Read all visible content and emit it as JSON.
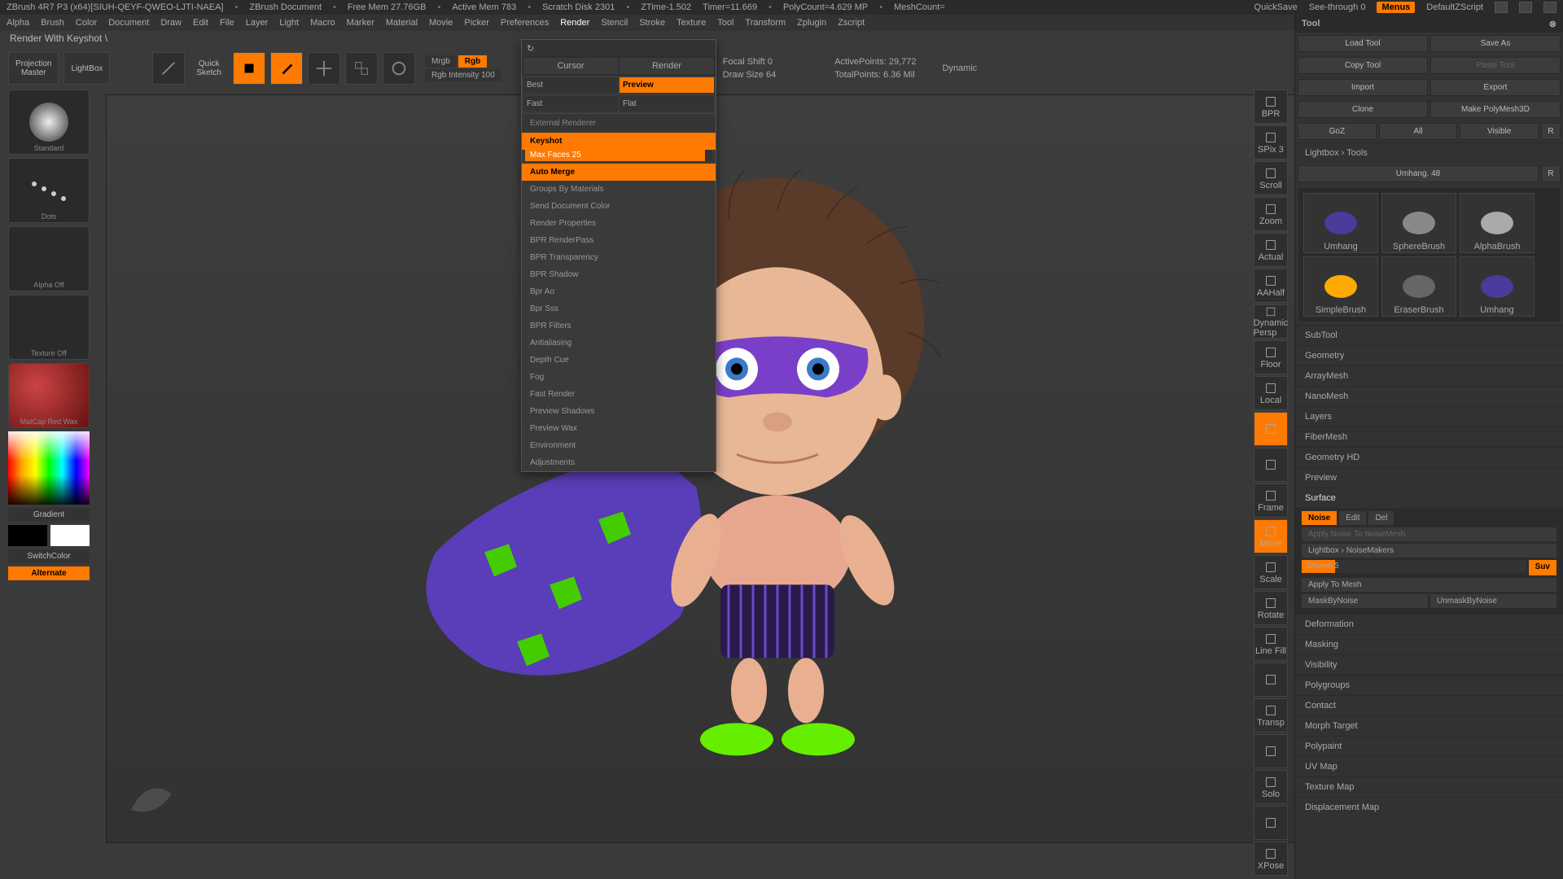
{
  "status": {
    "app": "ZBrush 4R7 P3 (x64)[SIUH-QEYF-QWEO-LJTI-NAEA]",
    "doc": "ZBrush Document",
    "mem": "Free Mem 27.76GB",
    "amem": "Active Mem 783",
    "scratch": "Scratch Disk 2301",
    "ztime": "ZTime-1.502",
    "timer": "Timer=11.669",
    "poly": "PolyCount=4.629 MP",
    "mesh": "MeshCount=",
    "quicksave": "QuickSave",
    "seethrough": "See-through  0",
    "menus": "Menus",
    "script": "DefaultZScript"
  },
  "menu": [
    "Alpha",
    "Brush",
    "Color",
    "Document",
    "Draw",
    "Edit",
    "File",
    "Layer",
    "Light",
    "Macro",
    "Marker",
    "Material",
    "Movie",
    "Picker",
    "Preferences",
    "Render",
    "Stencil",
    "Stroke",
    "Texture",
    "Tool",
    "Transform",
    "Zplugin",
    "Zscript"
  ],
  "menu_open_index": 15,
  "info": "Render With Keyshot  \\",
  "shelf": {
    "projection": "Projection\nMaster",
    "lightbox": "LightBox",
    "quicksketch": "Quick\nSketch",
    "mrgb": "Mrgb",
    "rgb": "Rgb",
    "rgbintensity": "Rgb Intensity 100",
    "focal": "Focal Shift 0",
    "draw": "Draw Size 64",
    "active": "ActivePoints: 29,772",
    "total": "TotalPoints: 6.36 Mil",
    "dynamic": "Dynamic"
  },
  "left": {
    "brush": "Standard",
    "stroke": "Dots",
    "alpha": "Alpha Off",
    "texture": "Texture Off",
    "material": "MatCap Red Wax",
    "gradient": "Gradient",
    "switch": "SwitchColor",
    "alternate": "Alternate"
  },
  "dropdown": {
    "cursor": "Cursor",
    "render": "Render",
    "best": "Best",
    "preview": "Preview",
    "fast": "Fast",
    "flat": "Flat",
    "ext_hdr": "External Renderer",
    "keyshot": "Keyshot",
    "maxfaces": "Max Faces 25",
    "automerge": "Auto Merge",
    "groups": "Groups By Materials",
    "senddoc": "Send Document Color",
    "sections": [
      "Render Properties",
      "BPR RenderPass",
      "BPR Transparency",
      "BPR Shadow",
      "Bpr Ao",
      "Bpr Sss",
      "BPR Filters",
      "Antialiasing",
      "Depth Cue",
      "Fog",
      "Fast Render",
      "Preview Shadows",
      "Preview Wax",
      "Environment",
      "Adjustments"
    ]
  },
  "rtool": [
    "BPR",
    "SPix 3",
    "Scroll",
    "Zoom",
    "Actual",
    "AAHalf",
    "Dynamic\nPersp",
    "Floor",
    "Local",
    "",
    "",
    "Frame",
    "Move",
    "Scale",
    "Rotate",
    "Line Fill",
    "",
    "Transp",
    "",
    "Solo",
    "",
    "XPose"
  ],
  "rtool_active": [
    9,
    12
  ],
  "tool": {
    "title": "Tool",
    "rows": [
      [
        "Load Tool",
        "Save As"
      ],
      [
        "Copy Tool",
        "Paste Tool"
      ],
      [
        "Import",
        "Export"
      ],
      [
        "Clone",
        "Make PolyMesh3D"
      ],
      [
        "GoZ",
        "All",
        "Visible",
        "R"
      ]
    ],
    "lightbox_tools": "Lightbox › Tools",
    "current": "Umhang. 48",
    "r": "R",
    "thumbs": [
      "Umhang",
      "SphereBrush",
      "AlphaBrush",
      "SimpleBrush",
      "EraserBrush",
      "Umhang"
    ],
    "acc": [
      "SubTool",
      "Geometry",
      "ArrayMesh",
      "NanoMesh",
      "Layers",
      "FiberMesh",
      "Geometry HD",
      "Preview"
    ],
    "surface": {
      "title": "Surface",
      "noise": "Noise",
      "edit": "Edit",
      "del": "Del",
      "apply_nm": "Apply Noise To NoiseMesh",
      "lightbox_nm": "Lightbox › NoiseMakers",
      "snorm": "SNorm 5",
      "suv": "Suv",
      "applymesh": "Apply To Mesh",
      "mask": "MaskByNoise",
      "unmask": "UnmaskByNoise"
    },
    "acc2": [
      "Deformation",
      "Masking",
      "Visibility",
      "Polygroups",
      "Contact",
      "Morph Target",
      "Polypaint",
      "UV Map",
      "Texture Map",
      "Displacement Map"
    ]
  }
}
